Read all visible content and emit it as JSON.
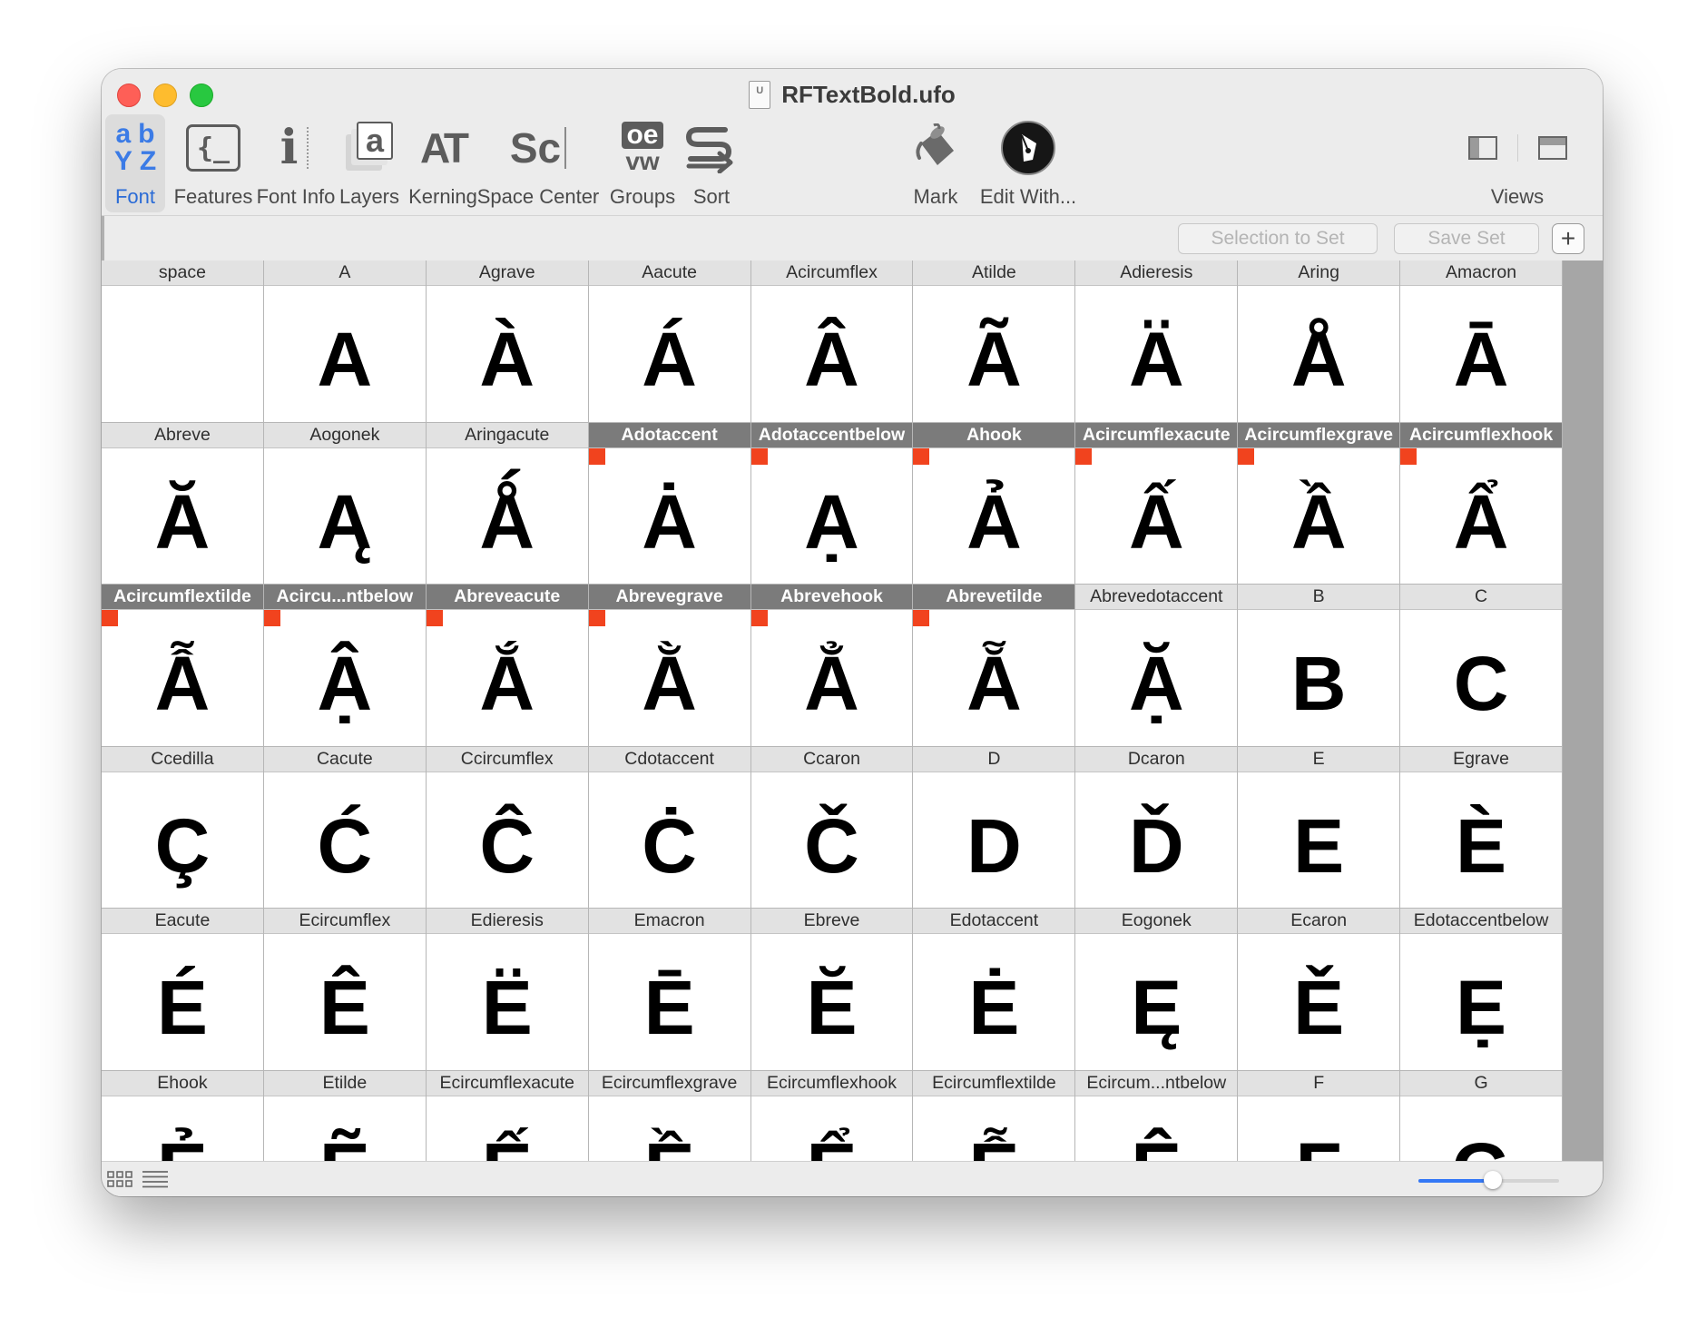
{
  "window": {
    "title": "RFTextBold.ufo",
    "doc_icon": "ufo-file-icon",
    "doc_icon_text": "U"
  },
  "toolbar": {
    "font": {
      "label": "Font",
      "a": "a",
      "b": "b",
      "y": "Y",
      "z": "Z"
    },
    "features": {
      "label": "Features",
      "glyph": "{_"
    },
    "font_info": {
      "label": "Font Info",
      "glyph": "i"
    },
    "layers": {
      "label": "Layers",
      "glyph": "a"
    },
    "kerning": {
      "label": "Kerning",
      "glyph": "AT"
    },
    "space_center": {
      "label": "Space Center",
      "glyph": "Sc"
    },
    "groups": {
      "label": "Groups",
      "top": "oe",
      "bottom": "vw"
    },
    "sort": {
      "label": "Sort"
    },
    "mark": {
      "label": "Mark"
    },
    "edit_with": {
      "label": "Edit With..."
    },
    "views": {
      "label": "Views"
    }
  },
  "sets": {
    "selection_to_set": "Selection to Set",
    "save_set": "Save Set",
    "add": "+"
  },
  "colors": {
    "mark": "#f1431e",
    "selected_header": "#7b7b7b",
    "accent": "#3478f6"
  },
  "glyphs": [
    {
      "name": "space",
      "char": " ",
      "selected": false,
      "marked": false
    },
    {
      "name": "A",
      "char": "A",
      "selected": false,
      "marked": false
    },
    {
      "name": "Agrave",
      "char": "À",
      "selected": false,
      "marked": false
    },
    {
      "name": "Aacute",
      "char": "Á",
      "selected": false,
      "marked": false
    },
    {
      "name": "Acircumflex",
      "char": "Â",
      "selected": false,
      "marked": false
    },
    {
      "name": "Atilde",
      "char": "Ã",
      "selected": false,
      "marked": false
    },
    {
      "name": "Adieresis",
      "char": "Ä",
      "selected": false,
      "marked": false
    },
    {
      "name": "Aring",
      "char": "Å",
      "selected": false,
      "marked": false
    },
    {
      "name": "Amacron",
      "char": "Ā",
      "selected": false,
      "marked": false
    },
    {
      "name": "Abreve",
      "char": "Ă",
      "selected": false,
      "marked": false
    },
    {
      "name": "Aogonek",
      "char": "Ą",
      "selected": false,
      "marked": false
    },
    {
      "name": "Aringacute",
      "char": "Ǻ",
      "selected": false,
      "marked": false
    },
    {
      "name": "Adotaccent",
      "char": "Ȧ",
      "selected": true,
      "marked": true
    },
    {
      "name": "Adotaccentbelow",
      "char": "Ạ",
      "selected": true,
      "marked": true
    },
    {
      "name": "Ahook",
      "char": "Ả",
      "selected": true,
      "marked": true
    },
    {
      "name": "Acircumflexacute",
      "char": "Ấ",
      "selected": true,
      "marked": true
    },
    {
      "name": "Acircumflexgrave",
      "char": "Ầ",
      "selected": true,
      "marked": true
    },
    {
      "name": "Acircumflexhook",
      "char": "Ẩ",
      "selected": true,
      "marked": true
    },
    {
      "name": "Acircumflextilde",
      "char": "Ẫ",
      "selected": true,
      "marked": true
    },
    {
      "name": "Acircu...ntbelow",
      "char": "Ậ",
      "selected": true,
      "marked": true
    },
    {
      "name": "Abreveacute",
      "char": "Ắ",
      "selected": true,
      "marked": true
    },
    {
      "name": "Abrevegrave",
      "char": "Ằ",
      "selected": true,
      "marked": true
    },
    {
      "name": "Abrevehook",
      "char": "Ẳ",
      "selected": true,
      "marked": true
    },
    {
      "name": "Abrevetilde",
      "char": "Ẵ",
      "selected": true,
      "marked": true
    },
    {
      "name": "Abrevedotaccent",
      "char": "Ặ",
      "selected": false,
      "marked": false
    },
    {
      "name": "B",
      "char": "B",
      "selected": false,
      "marked": false
    },
    {
      "name": "C",
      "char": "C",
      "selected": false,
      "marked": false
    },
    {
      "name": "Ccedilla",
      "char": "Ç",
      "selected": false,
      "marked": false
    },
    {
      "name": "Cacute",
      "char": "Ć",
      "selected": false,
      "marked": false
    },
    {
      "name": "Ccircumflex",
      "char": "Ĉ",
      "selected": false,
      "marked": false
    },
    {
      "name": "Cdotaccent",
      "char": "Ċ",
      "selected": false,
      "marked": false
    },
    {
      "name": "Ccaron",
      "char": "Č",
      "selected": false,
      "marked": false
    },
    {
      "name": "D",
      "char": "D",
      "selected": false,
      "marked": false
    },
    {
      "name": "Dcaron",
      "char": "Ď",
      "selected": false,
      "marked": false
    },
    {
      "name": "E",
      "char": "E",
      "selected": false,
      "marked": false
    },
    {
      "name": "Egrave",
      "char": "È",
      "selected": false,
      "marked": false
    },
    {
      "name": "Eacute",
      "char": "É",
      "selected": false,
      "marked": false
    },
    {
      "name": "Ecircumflex",
      "char": "Ê",
      "selected": false,
      "marked": false
    },
    {
      "name": "Edieresis",
      "char": "Ë",
      "selected": false,
      "marked": false
    },
    {
      "name": "Emacron",
      "char": "Ē",
      "selected": false,
      "marked": false
    },
    {
      "name": "Ebreve",
      "char": "Ĕ",
      "selected": false,
      "marked": false
    },
    {
      "name": "Edotaccent",
      "char": "Ė",
      "selected": false,
      "marked": false
    },
    {
      "name": "Eogonek",
      "char": "Ę",
      "selected": false,
      "marked": false
    },
    {
      "name": "Ecaron",
      "char": "Ě",
      "selected": false,
      "marked": false
    },
    {
      "name": "Edotaccentbelow",
      "char": "Ẹ",
      "selected": false,
      "marked": false
    },
    {
      "name": "Ehook",
      "char": "Ẻ",
      "selected": false,
      "marked": false
    },
    {
      "name": "Etilde",
      "char": "Ẽ",
      "selected": false,
      "marked": false
    },
    {
      "name": "Ecircumflexacute",
      "char": "Ế",
      "selected": false,
      "marked": false
    },
    {
      "name": "Ecircumflexgrave",
      "char": "Ề",
      "selected": false,
      "marked": false
    },
    {
      "name": "Ecircumflexhook",
      "char": "Ể",
      "selected": false,
      "marked": false
    },
    {
      "name": "Ecircumflextilde",
      "char": "Ễ",
      "selected": false,
      "marked": false
    },
    {
      "name": "Ecircum...ntbelow",
      "char": "Ệ",
      "selected": false,
      "marked": false
    },
    {
      "name": "F",
      "char": "F",
      "selected": false,
      "marked": false
    },
    {
      "name": "G",
      "char": "G",
      "selected": false,
      "marked": false
    }
  ],
  "status": {
    "grid_view_icon": "grid-view-icon",
    "list_view_icon": "list-view-icon",
    "zoom": 0.53
  }
}
